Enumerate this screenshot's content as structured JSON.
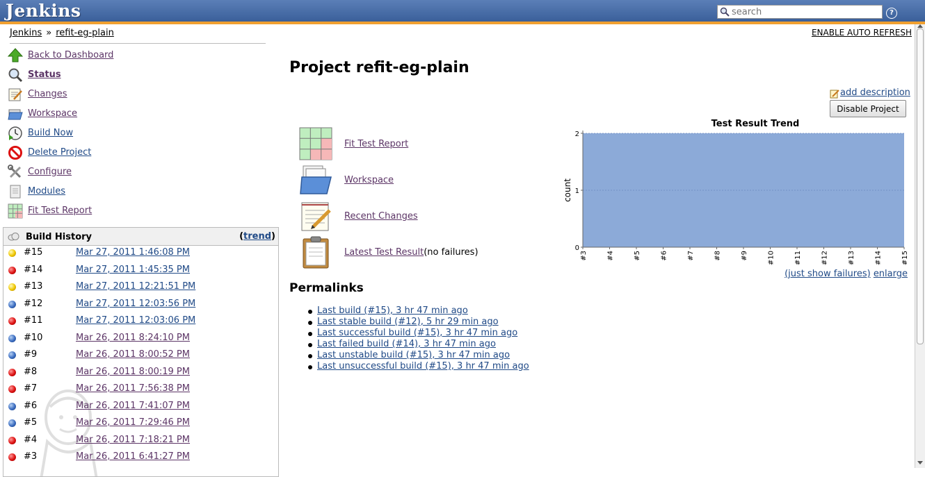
{
  "header": {
    "logo": "Jenkins",
    "search_placeholder": "search",
    "help_label": "?"
  },
  "breadcrumb": {
    "root": "Jenkins",
    "separator": "»",
    "current": "refit-eg-plain"
  },
  "auto_refresh": "ENABLE AUTO REFRESH",
  "side_tasks": [
    {
      "label": "Back to Dashboard",
      "icon": "up-arrow-icon"
    },
    {
      "label": "Status",
      "icon": "magnifier-icon"
    },
    {
      "label": "Changes",
      "icon": "notepad-icon"
    },
    {
      "label": "Workspace",
      "icon": "folder-icon"
    },
    {
      "label": "Build Now",
      "icon": "clock-icon"
    },
    {
      "label": "Delete Project",
      "icon": "no-entry-icon"
    },
    {
      "label": "Configure",
      "icon": "wrench-icon"
    },
    {
      "label": "Modules",
      "icon": "document-icon"
    },
    {
      "label": "Fit Test Report",
      "icon": "fit-grid-icon"
    }
  ],
  "build_history": {
    "title": "Build History",
    "trend_open": "(",
    "trend_label": "trend",
    "trend_close": ")",
    "builds": [
      {
        "num": "#15",
        "date": "Mar 27, 2011 1:46:08 PM",
        "status": "yellow"
      },
      {
        "num": "#14",
        "date": "Mar 27, 2011 1:45:35 PM",
        "status": "red"
      },
      {
        "num": "#13",
        "date": "Mar 27, 2011 12:21:51 PM",
        "status": "yellow"
      },
      {
        "num": "#12",
        "date": "Mar 27, 2011 12:03:56 PM",
        "status": "blue"
      },
      {
        "num": "#11",
        "date": "Mar 27, 2011 12:03:06 PM",
        "status": "red"
      },
      {
        "num": "#10",
        "date": "Mar 26, 2011 8:24:10 PM",
        "status": "blue"
      },
      {
        "num": "#9",
        "date": "Mar 26, 2011 8:00:52 PM",
        "status": "blue"
      },
      {
        "num": "#8",
        "date": "Mar 26, 2011 8:00:19 PM",
        "status": "red"
      },
      {
        "num": "#7",
        "date": "Mar 26, 2011 7:56:38 PM",
        "status": "red"
      },
      {
        "num": "#6",
        "date": "Mar 26, 2011 7:41:07 PM",
        "status": "blue"
      },
      {
        "num": "#5",
        "date": "Mar 26, 2011 7:29:46 PM",
        "status": "blue"
      },
      {
        "num": "#4",
        "date": "Mar 26, 2011 7:18:21 PM",
        "status": "red"
      },
      {
        "num": "#3",
        "date": "Mar 26, 2011 6:41:27 PM",
        "status": "red"
      }
    ]
  },
  "main": {
    "title": "Project refit-eg-plain",
    "add_description": "add description",
    "disable_button": "Disable Project",
    "links": [
      {
        "label": "Fit Test Report",
        "extra": "",
        "icon": "fit-grid-icon"
      },
      {
        "label": "Workspace",
        "extra": "",
        "icon": "folder-icon"
      },
      {
        "label": "Recent Changes",
        "extra": "",
        "icon": "notepad-icon"
      },
      {
        "label": "Latest Test Result",
        "extra": "(no failures)",
        "icon": "clipboard-icon"
      }
    ],
    "permalinks_title": "Permalinks",
    "permalinks": [
      "Last build (#15), 3 hr 47 min ago",
      "Last stable build (#12), 5 hr 29 min ago",
      "Last successful build (#15), 3 hr 47 min ago",
      "Last failed build (#14), 3 hr 47 min ago",
      "Last unstable build (#15), 3 hr 47 min ago",
      "Last unsuccessful build (#15), 3 hr 47 min ago"
    ],
    "show_failures": "(just show failures)",
    "enlarge": "enlarge"
  },
  "chart_data": {
    "type": "area",
    "title": "Test Result Trend",
    "xlabel": "",
    "ylabel": "count",
    "categories": [
      "#3",
      "#4",
      "#5",
      "#6",
      "#7",
      "#8",
      "#9",
      "#10",
      "#11",
      "#12",
      "#13",
      "#14",
      "#15"
    ],
    "series": [
      {
        "values": [
          2,
          2,
          2,
          2,
          2,
          2,
          2,
          2,
          2,
          2,
          2,
          2,
          2
        ],
        "color": "#8caad8"
      }
    ],
    "ylim": [
      0,
      2
    ],
    "yticks": [
      0,
      1,
      2
    ],
    "grid": true
  },
  "colors": {
    "header": "#3a5f9a",
    "accent_stripe": "#f0a030",
    "link": "#204a87",
    "visited_link": "#5c3566"
  }
}
